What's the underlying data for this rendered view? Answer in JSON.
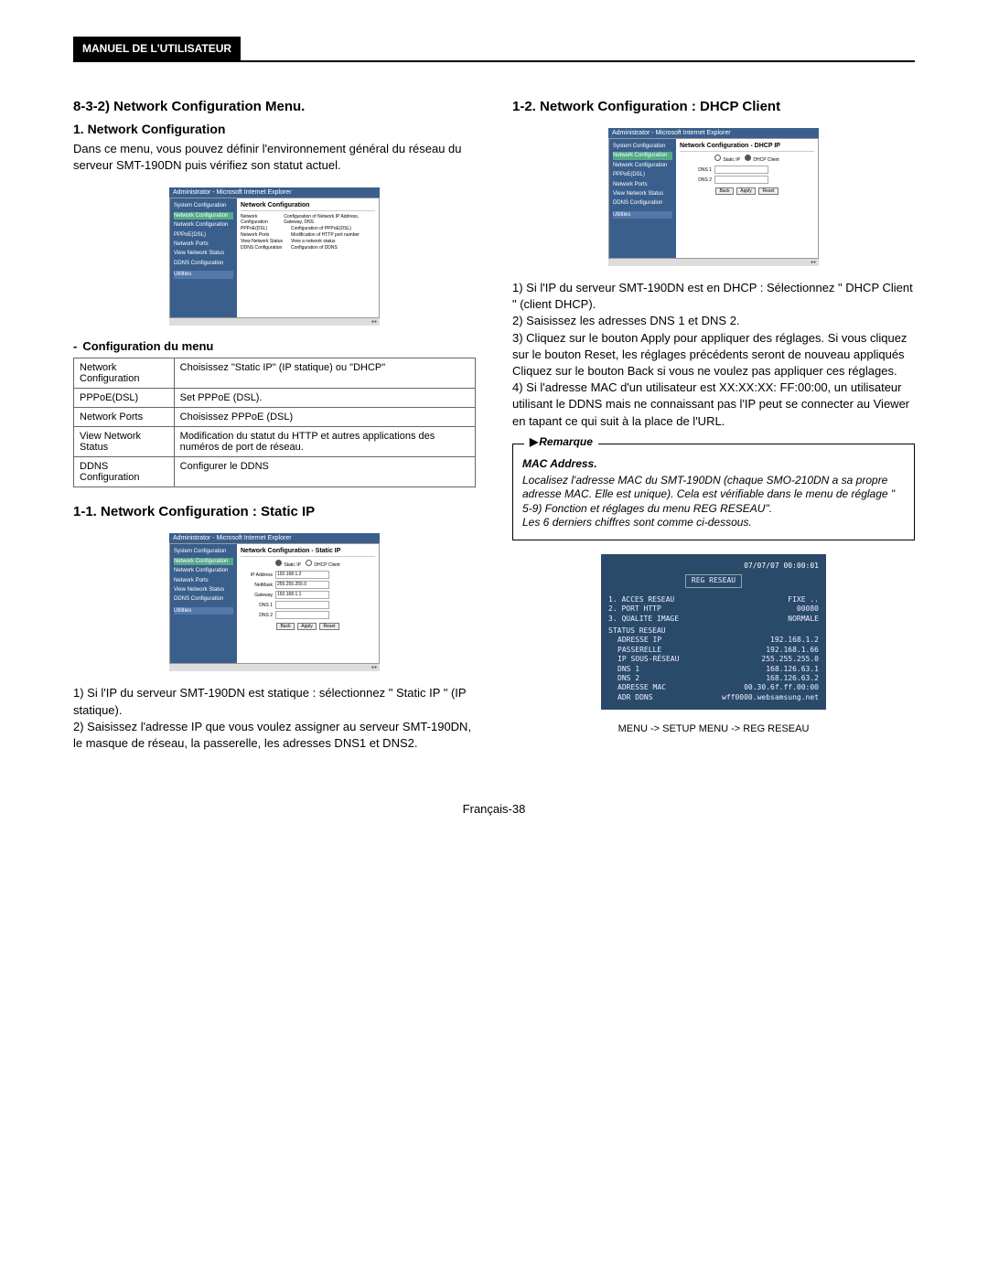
{
  "header": "MANUEL DE L'UTILISATEUR",
  "left": {
    "h1": "8-3-2) Network Configuration Menu.",
    "h2": "1. Network Configuration",
    "intro": "Dans ce menu, vous pouvez définir l'environnement général du réseau du serveur SMT-190DN puis vérifiez son statut actuel.",
    "ss1": {
      "title": "Administrator - Microsoft Internet Explorer",
      "mainTitle": "Network Configuration",
      "sidebar": [
        "System Configuration",
        "Network Configuration",
        "Network Configuration",
        "PPPoE(DSL)",
        "Network Ports",
        "View Network Status",
        "DDNS Configuration",
        "Utilities"
      ],
      "rows": [
        [
          "Network Configuration",
          "Configuration of Network IP Address, Gateway, DNS"
        ],
        [
          "PPPoE(DSL)",
          "Configuration of PPPoE(DSL)"
        ],
        [
          "Network Ports",
          "Modification of HTTP port number"
        ],
        [
          "View Network Status",
          "View a network status"
        ],
        [
          "DDNS Configuration",
          "Configuration of DDNS"
        ]
      ]
    },
    "menuTitle": "Configuration du menu",
    "table": [
      [
        "Network Configuration",
        "Choisissez \"Static IP\" (IP statique) ou \"DHCP\""
      ],
      [
        "PPPoE(DSL)",
        "Set PPPoE (DSL)."
      ],
      [
        "Network Ports",
        "Choisissez PPPoE (DSL)"
      ],
      [
        "View Network Status",
        "Modification du statut du HTTP et autres applications des numéros de port de réseau."
      ],
      [
        "DDNS Configuration",
        "Configurer le DDNS"
      ]
    ],
    "h3": "1-1. Network Configuration : Static IP",
    "ss2": {
      "title": "Administrator - Microsoft Internet Explorer",
      "mainTitle": "Network Configuration - Static IP",
      "radios": [
        "Static IP",
        "DHCP Client"
      ],
      "fields": [
        [
          "IP Address",
          "192.168.1.2"
        ],
        [
          "NetMask",
          "255.255.255.0"
        ],
        [
          "Gateway",
          "192.168.1.1"
        ],
        [
          "DNS 1",
          ""
        ],
        [
          "DNS 2",
          ""
        ]
      ],
      "buttons": [
        "Back",
        "Apply",
        "Reset"
      ]
    },
    "steps": "1) Si l'IP du serveur SMT-190DN est statique : sélectionnez \" Static IP \" (IP statique).\n2) Saisissez l'adresse IP que vous voulez assigner au serveur SMT-190DN, le masque de réseau, la passerelle, les adresses DNS1 et DNS2."
  },
  "right": {
    "h1": "1-2. Network Configuration : DHCP Client",
    "ss3": {
      "title": "Administrator - Microsoft Internet Explorer",
      "mainTitle": "Network Configuration - DHCP IP",
      "radios": [
        "Static IP",
        "DHCP Client"
      ],
      "fields": [
        [
          "DNS 1",
          ""
        ],
        [
          "DNS 2",
          ""
        ]
      ],
      "buttons": [
        "Back",
        "Apply",
        "Reset"
      ]
    },
    "steps": "1) Si l'IP du serveur SMT-190DN est en DHCP : Sélectionnez \" DHCP Client \" (client DHCP).\n2) Saisissez les adresses DNS 1 et DNS 2.\n3) Cliquez sur le bouton Apply pour appliquer des réglages. Si vous cliquez sur le bouton Reset, les réglages précédents seront de nouveau appliqués Cliquez sur le bouton Back si vous ne voulez pas appliquer ces réglages.\n4) Si l'adresse MAC d'un utilisateur est XX:XX:XX: FF:00:00, un utilisateur utilisant le DDNS mais ne connaissant pas l'IP peut se connecter au Viewer en tapant ce qui suit à la place de l'URL.",
    "noteTitle": "Remarque",
    "noteSub": "MAC Address.",
    "noteBody": "Localisez l'adresse MAC du SMT-190DN (chaque SMO-210DN a sa propre adresse MAC. Elle est unique). Cela est vérifiable dans le menu de réglage \" 5-9) Fonction et réglages du menu REG RESEAU\".\nLes 6 derniers chiffres sont comme ci-dessous.",
    "reg": {
      "datetime": "07/07/07  00:00:01",
      "title": "REG RESEAU",
      "top": [
        [
          "1. ACCES RESEAU",
          "FIXE .."
        ],
        [
          "2. PORT HTTP",
          "00080"
        ],
        [
          "3. QUALITE IMAGE",
          "NORMALE"
        ]
      ],
      "statusTitle": "STATUS RESEAU",
      "status": [
        [
          "ADRESSE IP",
          "192.168.1.2"
        ],
        [
          "PASSERELLE",
          "192.168.1.66"
        ],
        [
          "IP SOUS-RÉSEAU",
          "255.255.255.0"
        ],
        [
          "DNS 1",
          "168.126.63.1"
        ],
        [
          "DNS 2",
          "168.126.63.2"
        ],
        [
          "ADRESSE MAC",
          "00.30.6f.ff.00:00"
        ],
        [
          "ADR DDNS",
          "wff0000.websamsung.net"
        ]
      ]
    },
    "caption": "MENU -> SETUP MENU -> REG RESEAU"
  },
  "footer": "Français-38"
}
